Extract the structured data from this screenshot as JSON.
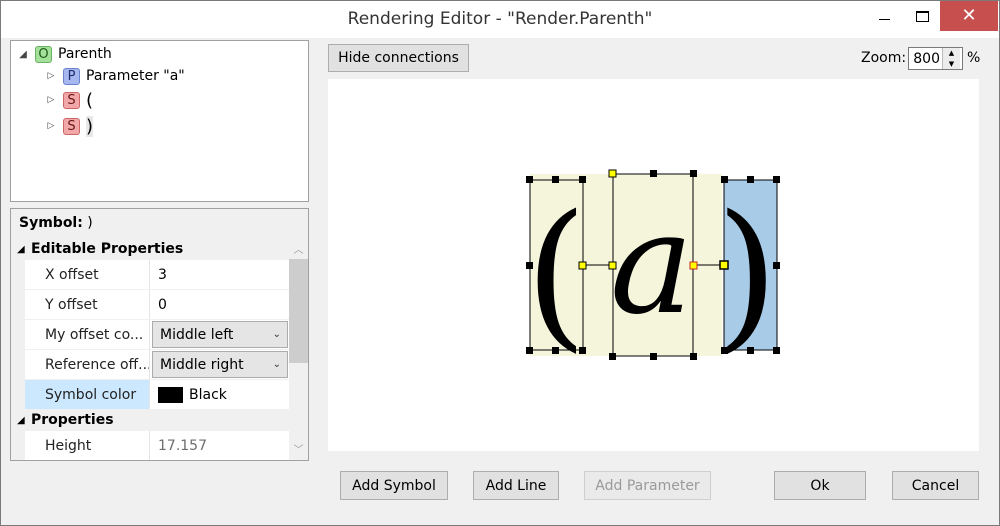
{
  "window": {
    "title": "Rendering Editor - \"Render.Parenth\"",
    "close_glyph": "✕"
  },
  "tree": {
    "root": {
      "badge": "O",
      "label": "Parenth"
    },
    "children": [
      {
        "badge": "P",
        "label": "Parameter \"a\""
      },
      {
        "badge": "S",
        "label": "("
      },
      {
        "badge": "S",
        "label": ")"
      }
    ]
  },
  "properties": {
    "symbol_prefix": "Symbol:",
    "symbol_value": ")",
    "editable_group": "Editable Properties",
    "properties_group": "Properties",
    "rows": [
      {
        "name": "X offset",
        "value": "3"
      },
      {
        "name": "Y offset",
        "value": "0"
      },
      {
        "name": "My offset co...",
        "value": "Middle left"
      },
      {
        "name": "Reference off...",
        "value": "Middle right"
      },
      {
        "name": "Symbol color",
        "value": "Black",
        "swatch": "#000000"
      }
    ],
    "readonly_rows": [
      {
        "name": "Height",
        "value": "17.157"
      }
    ]
  },
  "toolbar": {
    "hide_connections": "Hide connections",
    "zoom_label": "Zoom:",
    "zoom_value": "800",
    "zoom_unit": "%"
  },
  "buttons": {
    "add_symbol": "Add Symbol",
    "add_line": "Add Line",
    "add_parameter": "Add Parameter",
    "ok": "Ok",
    "cancel": "Cancel"
  },
  "canvas": {
    "glyph_open": "(",
    "glyph_param": "a",
    "glyph_close": ")"
  },
  "colors": {
    "symbol_bg": "#f5f5dc",
    "selected_symbol_bg": "#a8cce8",
    "anchor_selected": "#ffff00",
    "anchor_reference": "#cc2222",
    "close_button": "#c7504f",
    "selection_highlight": "#cce8ff"
  }
}
